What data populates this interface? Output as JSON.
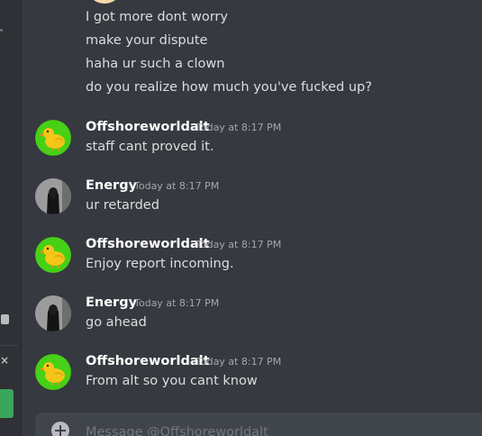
{
  "continuation_lines": [
    "I got more dont worry",
    "make your dispute",
    "haha ur such a clown",
    "do you realize how much you've fucked up?"
  ],
  "messages": [
    {
      "author": "Offshoreworldalt",
      "time": "Today at 8:17 PM",
      "content": "staff cant proved it.",
      "avatar": "chick-icon"
    },
    {
      "author": "Energy",
      "time": "Today at 8:17 PM",
      "content": "ur retarded",
      "avatar": "dark-figure-avatar"
    },
    {
      "author": "Offshoreworldalt",
      "time": "Today at 8:17 PM",
      "content": "Enjoy report incoming.",
      "avatar": "chick-icon"
    },
    {
      "author": "Energy",
      "time": "Today at 8:17 PM",
      "content": "go ahead",
      "avatar": "dark-figure-avatar"
    },
    {
      "author": "Offshoreworldalt",
      "time": "Today at 8:17 PM",
      "content": "From alt so you cant know",
      "avatar": "chick-icon"
    }
  ],
  "composer": {
    "placeholder": "Message @Offshoreworldalt"
  },
  "colors": {
    "background": "#36393f",
    "author": "#ffffff",
    "text": "#dcddde",
    "timestamp": "#a3a6aa",
    "chick_avatar_bg": "#46d016",
    "sidebar_button": "#3ba55d"
  }
}
